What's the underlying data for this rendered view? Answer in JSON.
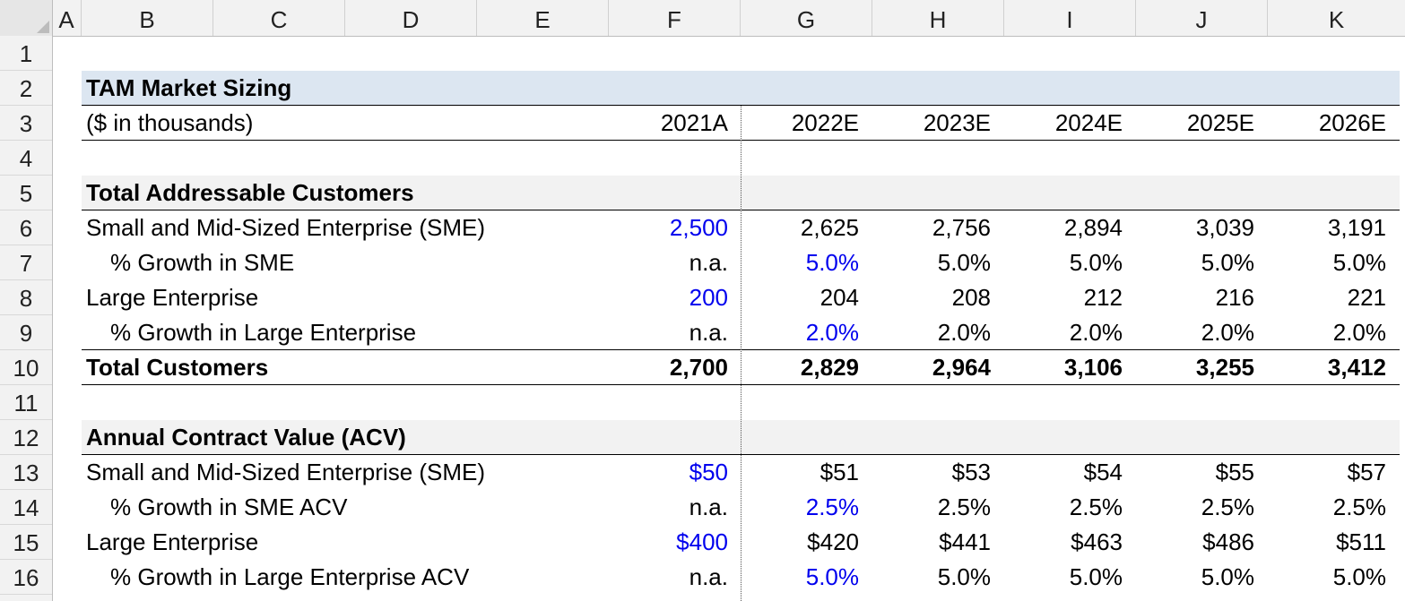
{
  "columns": [
    "A",
    "B",
    "C",
    "D",
    "E",
    "F",
    "G",
    "H",
    "I",
    "J",
    "K"
  ],
  "row_numbers": [
    "1",
    "2",
    "3",
    "4",
    "5",
    "6",
    "7",
    "8",
    "9",
    "10",
    "11",
    "12",
    "13",
    "14",
    "15",
    "16"
  ],
  "title": "TAM Market Sizing",
  "units_label": "($ in thousands)",
  "years": [
    "2021A",
    "2022E",
    "2023E",
    "2024E",
    "2025E",
    "2026E"
  ],
  "customers": {
    "section_title": "Total Addressable Customers",
    "sme": {
      "label": "Small and Mid-Sized Enterprise (SME)",
      "values": [
        "2,500",
        "2,625",
        "2,756",
        "2,894",
        "3,039",
        "3,191"
      ]
    },
    "sme_growth": {
      "label": "% Growth in SME",
      "values": [
        "n.a.",
        "5.0%",
        "5.0%",
        "5.0%",
        "5.0%",
        "5.0%"
      ]
    },
    "large": {
      "label": "Large Enterprise",
      "values": [
        "200",
        "204",
        "208",
        "212",
        "216",
        "221"
      ]
    },
    "large_growth": {
      "label": "% Growth in Large Enterprise",
      "values": [
        "n.a.",
        "2.0%",
        "2.0%",
        "2.0%",
        "2.0%",
        "2.0%"
      ]
    },
    "total": {
      "label": "Total Customers",
      "values": [
        "2,700",
        "2,829",
        "2,964",
        "3,106",
        "3,255",
        "3,412"
      ]
    }
  },
  "acv": {
    "section_title": "Annual Contract Value (ACV)",
    "sme": {
      "label": "Small and Mid-Sized Enterprise (SME)",
      "values": [
        "$50",
        "$51",
        "$53",
        "$54",
        "$55",
        "$57"
      ]
    },
    "sme_growth": {
      "label": "% Growth in SME ACV",
      "values": [
        "n.a.",
        "2.5%",
        "2.5%",
        "2.5%",
        "2.5%",
        "2.5%"
      ]
    },
    "large": {
      "label": "Large Enterprise",
      "values": [
        "$400",
        "$420",
        "$441",
        "$463",
        "$486",
        "$511"
      ]
    },
    "large_growth": {
      "label": "% Growth in Large Enterprise ACV",
      "values": [
        "n.a.",
        "5.0%",
        "5.0%",
        "5.0%",
        "5.0%",
        "5.0%"
      ]
    }
  },
  "colors": {
    "input_blue": "#0000ee",
    "title_band": "#dce6f1",
    "section_band": "#f2f2f2",
    "header_bg": "#f2f2f2"
  }
}
